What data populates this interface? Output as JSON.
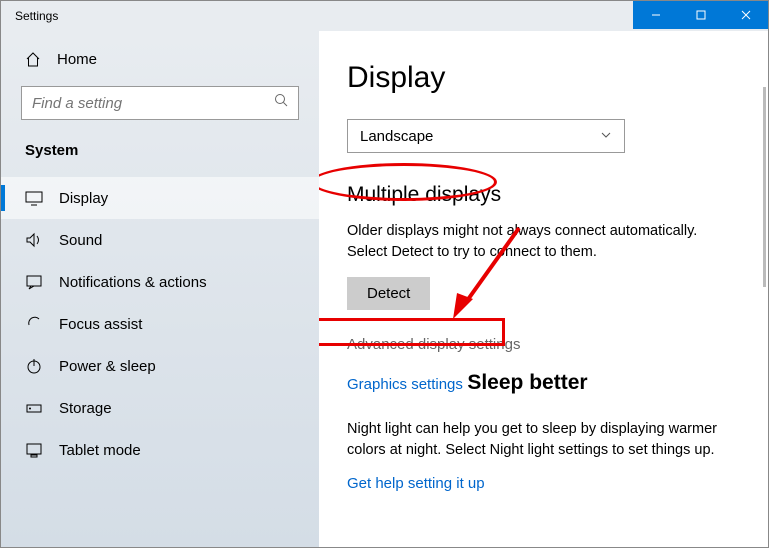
{
  "window": {
    "title": "Settings"
  },
  "sidebar": {
    "home": "Home",
    "search_placeholder": "Find a setting",
    "category": "System",
    "items": [
      {
        "label": "Display"
      },
      {
        "label": "Sound"
      },
      {
        "label": "Notifications & actions"
      },
      {
        "label": "Focus assist"
      },
      {
        "label": "Power & sleep"
      },
      {
        "label": "Storage"
      },
      {
        "label": "Tablet mode"
      }
    ]
  },
  "main": {
    "title": "Display",
    "orientation_selected": "Landscape",
    "multiple_displays": {
      "heading": "Multiple displays",
      "body": "Older displays might not always connect automatically. Select Detect to try to connect to them.",
      "detect_btn": "Detect",
      "advanced_link": "Advanced display settings",
      "graphics_link": "Graphics settings"
    },
    "sleep_better": {
      "heading": "Sleep better",
      "body": "Night light can help you get to sleep by displaying warmer colors at night. Select Night light settings to set things up.",
      "link": "Get help setting it up"
    }
  }
}
